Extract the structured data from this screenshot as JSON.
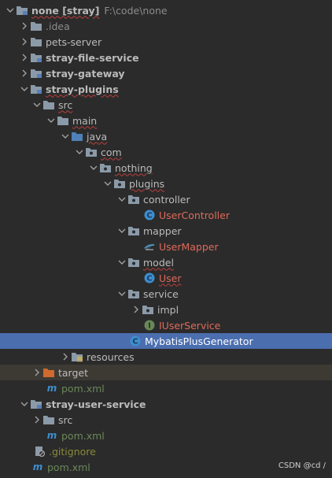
{
  "tree": {
    "root": {
      "name": "none [stray]",
      "path": "F:\\code\\none"
    },
    "idea": ".idea",
    "pets_server": "pets-server",
    "stray_file_service": "stray-file-service",
    "stray_gateway": "stray-gateway",
    "stray_plugins": "stray-plugins",
    "src": "src",
    "main": "main",
    "java": "java",
    "com": "com",
    "nothing": "nothing",
    "plugins": "plugins",
    "controller": "controller",
    "user_controller": "UserController",
    "mapper": "mapper",
    "user_mapper": "UserMapper",
    "model": "model",
    "user": "User",
    "service": "service",
    "impl": "impl",
    "iuser_service": "IUserService",
    "generator": "MybatisPlusGenerator",
    "resources": "resources",
    "target": "target",
    "pom_plugins": "pom.xml",
    "stray_user_service": "stray-user-service",
    "user_src": "src",
    "pom_user": "pom.xml",
    "gitignore": ".gitignore",
    "pom_root": "pom.xml"
  },
  "watermark": "CSDN @cd /",
  "colors": {
    "background": "#2b2b2b",
    "selection": "#4b6eaf",
    "excluded": "#3c3a33",
    "folder": "#8b9aa8",
    "class_icon": "#3d8ecf",
    "interface_icon": "#6a8759",
    "modified_file": "#de6a5a",
    "new_file": "#6a8759"
  },
  "icons": {
    "folder": "folder-icon",
    "module": "module-folder-icon",
    "source_root": "source-root-icon",
    "package": "package-icon",
    "class": "class-icon",
    "interface": "interface-icon",
    "mapper": "mybatis-mapper-icon",
    "maven": "maven-icon",
    "git": "gitignore-icon",
    "excluded": "excluded-folder-icon",
    "resources": "resources-root-icon"
  }
}
